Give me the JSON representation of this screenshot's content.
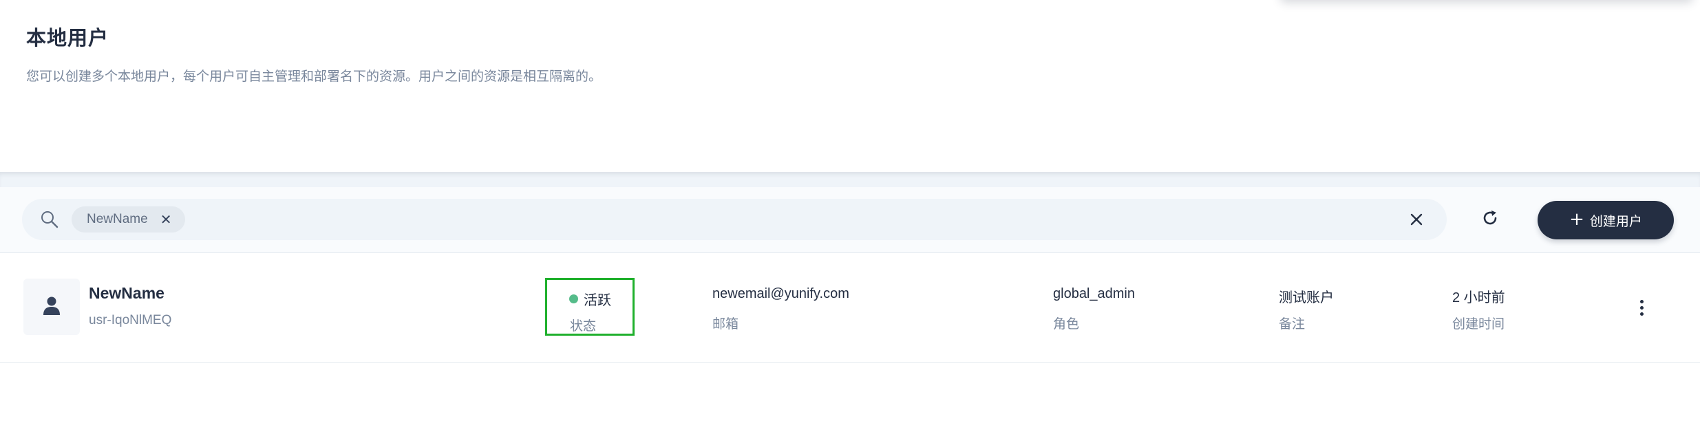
{
  "header": {
    "title": "本地用户",
    "description": "您可以创建多个本地用户，每个用户可自主管理和部署名下的资源。用户之间的资源是相互隔离的。"
  },
  "toolbar": {
    "search_icon": "search-icon",
    "filter_tag": "NewName",
    "clear_icon": "close-icon",
    "refresh_icon": "refresh-icon",
    "create_label": "创建用户",
    "create_icon": "plus-icon"
  },
  "users": [
    {
      "name": "NewName",
      "id": "usr-IqoNlMEQ",
      "status": "活跃",
      "status_label": "状态",
      "email": "newemail@yunify.com",
      "email_label": "邮箱",
      "role": "global_admin",
      "role_label": "角色",
      "note": "测试账户",
      "note_label": "备注",
      "created": "2 小时前",
      "created_label": "创建时间"
    }
  ],
  "colors": {
    "primary_dark": "#242e42",
    "muted_text": "#79879c",
    "status_active": "#55bc8a",
    "highlight_border": "#1fb02c",
    "toolbar_bg": "#eff4f9"
  }
}
